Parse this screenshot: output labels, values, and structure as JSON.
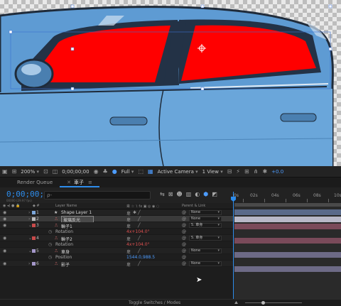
{
  "viewer_toolbar": {
    "zoom": "200%",
    "timecode": "0;00;00;00",
    "resolution": "Full",
    "camera": "Active Camera",
    "view": "1 View",
    "exposure": "+0.0"
  },
  "panel_tabs": [
    {
      "label": "Render Queue",
      "active": false
    },
    {
      "label": "車子",
      "active": true
    }
  ],
  "timeline": {
    "timecode": "0;00;00;00",
    "fps": "00000 (29.97 fps)",
    "search_placeholder": "ρ-",
    "ruler": [
      "0s",
      "02s",
      "04s",
      "06s",
      "08s",
      "10s"
    ],
    "columns": {
      "label_name": "Layer Name",
      "parent": "Parent & Link"
    }
  },
  "layers": [
    {
      "kind": "layer",
      "num": "1",
      "name": "Shape Layer 1",
      "type": "shape",
      "color": "#7da7d9",
      "parent": "None",
      "bar_color": "#5a6a8a",
      "selected": false
    },
    {
      "kind": "layer",
      "num": "2",
      "name": "玻璃反光",
      "type": "image",
      "color": "#bcbcbc",
      "parent": "None",
      "bar_color": "#b8b8c8",
      "selected": true
    },
    {
      "kind": "layer",
      "num": "3",
      "name": "輪子1",
      "type": "image",
      "color": "#c94b4b",
      "parent": "5. 車身",
      "bar_color": "#7a4a5a",
      "selected": false
    },
    {
      "kind": "prop",
      "name": "Rotation",
      "value": "4x+104.0°",
      "blue": false
    },
    {
      "kind": "layer",
      "num": "4",
      "name": "輪子2",
      "type": "image",
      "color": "#c94b4b",
      "parent": "5. 車身",
      "bar_color": "#7a4a5a",
      "selected": false
    },
    {
      "kind": "prop",
      "name": "Rotation",
      "value": "4x+104.0°",
      "blue": false
    },
    {
      "kind": "layer",
      "num": "5",
      "name": "車身",
      "type": "image",
      "color": "#a497c9",
      "parent": "None",
      "bar_color": "#6d6a86",
      "selected": false
    },
    {
      "kind": "prop",
      "name": "Position",
      "value": "1544.0,988.5",
      "blue": true
    },
    {
      "kind": "layer",
      "num": "6",
      "name": "影子",
      "type": "image",
      "color": "#a497c9",
      "parent": "None",
      "bar_color": "#6d6a86",
      "selected": false
    }
  ],
  "footer": {
    "label": "Toggle Switches / Modes"
  },
  "colors": {
    "accent": "#2d8ceb",
    "car_body": "#5e9bd3",
    "window": "#ff0000"
  }
}
